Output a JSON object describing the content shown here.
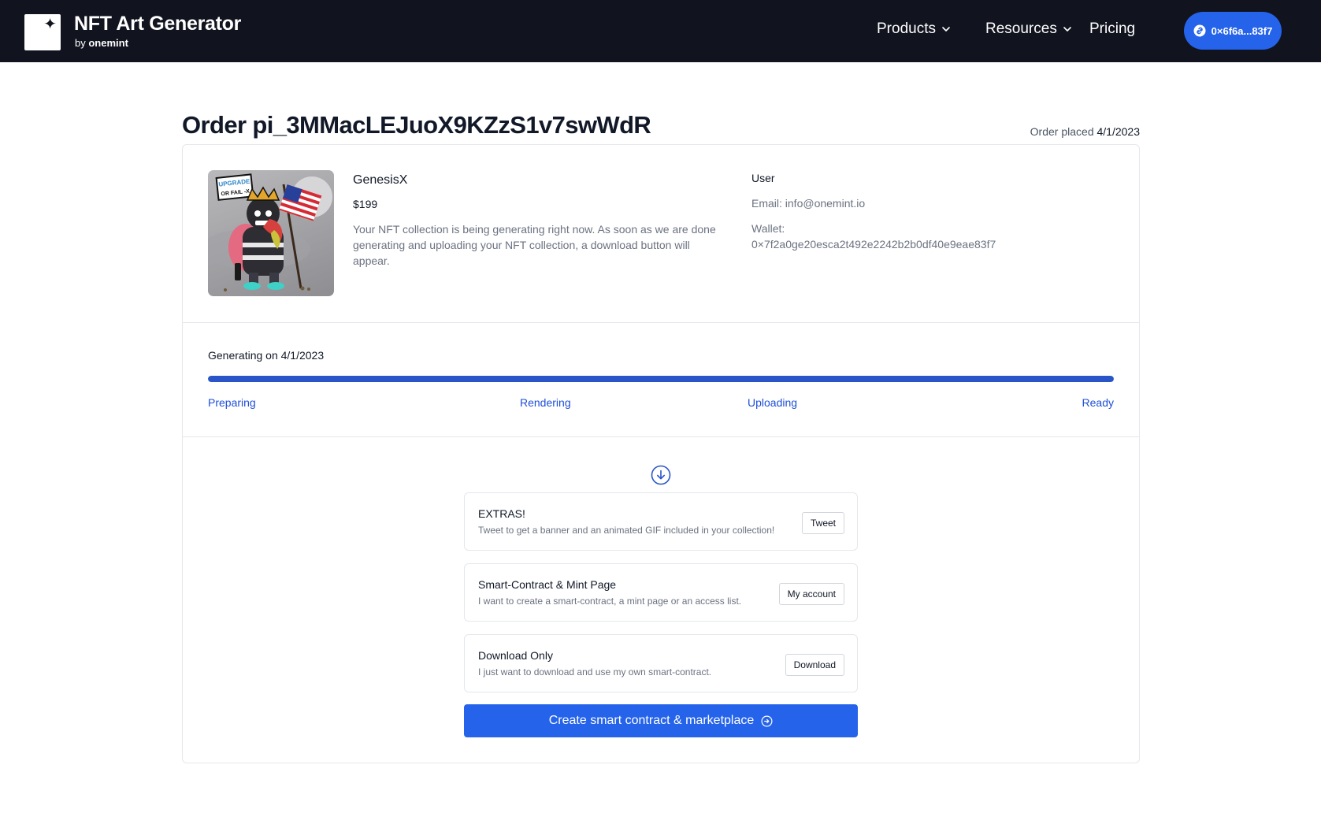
{
  "header": {
    "brand_title": "NFT Art Generator",
    "brand_by": "by",
    "brand_company": "onemint",
    "nav": [
      {
        "label": "Products",
        "has_dropdown": true
      },
      {
        "label": "Resources",
        "has_dropdown": true
      },
      {
        "label": "Pricing",
        "has_dropdown": false
      }
    ],
    "wallet_label": "0×6f6a...83f7"
  },
  "order": {
    "title": "Order pi_3MMacLEJuoX9KZzS1v7swWdR",
    "placed_label": "Order placed",
    "placed_date": "4/1/2023"
  },
  "product": {
    "name": "GenesisX",
    "price": "$199",
    "description": "Your NFT collection is being generating right now. As soon as we are done generating and uploading your NFT collection, a download button will appear.",
    "image_sign_line1": "UPGRADE",
    "image_sign_line2": "OR FAIL -X"
  },
  "user": {
    "title": "User",
    "email": "Email: info@onemint.io",
    "wallet_label": "Wallet:",
    "wallet": "0×7f2a0ge20esca2t492e2242b2b0df40e9eae83f7"
  },
  "progress": {
    "label": "Generating on 4/1/2023",
    "percent": 100,
    "steps": [
      "Preparing",
      "Rendering",
      "Uploading",
      "Ready"
    ]
  },
  "options": [
    {
      "title": "EXTRAS!",
      "description": "Tweet to get a banner and an animated GIF included in your collection!",
      "button": "Tweet"
    },
    {
      "title": "Smart-Contract & Mint Page",
      "description": "I want to create a smart-contract, a mint page or an access list.",
      "button": "My account"
    },
    {
      "title": "Download Only",
      "description": "I just want to download and use my own smart-contract.",
      "button": "Download"
    }
  ],
  "cta_label": "Create smart contract & marketplace",
  "colors": {
    "header_bg": "#11131f",
    "accent": "#2563eb",
    "progress_fill": "#2a55c9",
    "step_text": "#1d4ed8"
  },
  "icons": [
    "sparkle-icon",
    "chevron-down-icon",
    "link-icon",
    "arrow-down-circle-icon",
    "arrow-right-circle-icon"
  ]
}
